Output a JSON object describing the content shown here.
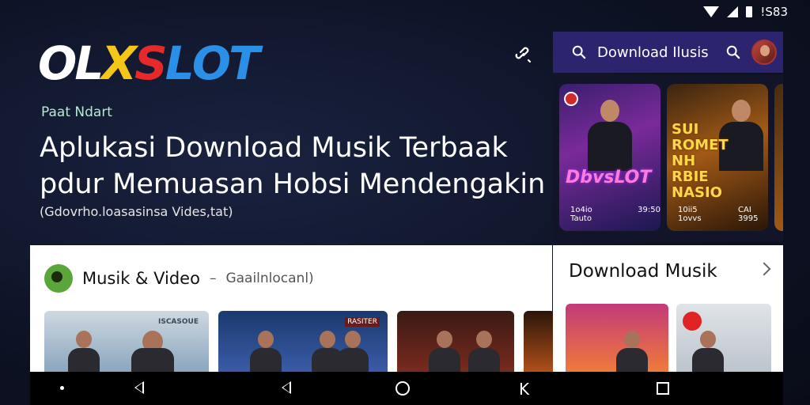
{
  "status_bar": {
    "time": "!S83"
  },
  "brand": {
    "logo_letters": [
      "O",
      "L",
      "X",
      "S",
      "L",
      "O",
      "T"
    ],
    "logo_colors": [
      "#ffffff",
      "#ffffff",
      "#f5c518",
      "#e62a2a",
      "#2a8fe6",
      "#2a8fe6",
      "#2a8fe6"
    ]
  },
  "hero": {
    "kicker": "Paat Ndart",
    "headline_line1": "Aplukasi Download Musik Terbaak",
    "headline_line2": "pdur Memuasan Hobsi Mendengakin",
    "subline": "(Gdovrho.loasasinsa Vides,tat)"
  },
  "search": {
    "query": "Download Ilusis",
    "search_icon": "search-icon"
  },
  "posters": [
    {
      "title": "DbvsLOT",
      "meta_left": "1o4io Tauto",
      "meta_right": "39:50"
    },
    {
      "title": "SUI ROMET NH RBIE NASIO",
      "meta_left": "10ii5 1ovvs",
      "meta_right": "CAI 3995"
    }
  ],
  "main_card": {
    "title": "Musik & Video",
    "separator": "–",
    "subtitle": "Gaailnlocanl)",
    "thumb_tags": [
      "ISCASOUE",
      "RASITER",
      "",
      ""
    ]
  },
  "side_card": {
    "title": "Download Musik"
  },
  "colors": {
    "search_bar": "#2d2470",
    "accent_green": "#5aa63a"
  }
}
